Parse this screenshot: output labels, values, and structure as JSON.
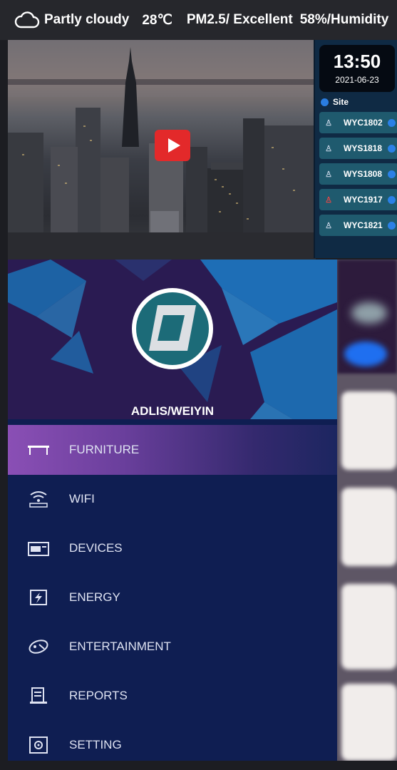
{
  "status_bar": {
    "weather_icon": "cloud-icon",
    "weather": "Partly cloudy",
    "temperature": "28℃",
    "air_quality": "PM2.5/ Excellent",
    "humidity": "58%/Humidity"
  },
  "video": {
    "play_icon": "play-icon"
  },
  "side_panel": {
    "time": "13:50",
    "date": "2021-06-23",
    "site_label": "Site",
    "devices": [
      {
        "name": "WYC1802",
        "status": "normal"
      },
      {
        "name": "WYS1818",
        "status": "normal"
      },
      {
        "name": "WYS1808",
        "status": "normal"
      },
      {
        "name": "WYC1917",
        "status": "alert"
      },
      {
        "name": "WYC1821",
        "status": "normal"
      }
    ]
  },
  "drawer": {
    "brand": "ADLIS/WEIYIN",
    "menu": [
      {
        "label": "FURNITURE",
        "icon": "table-icon",
        "active": true
      },
      {
        "label": "WIFI",
        "icon": "wifi-icon",
        "active": false
      },
      {
        "label": "DEVICES",
        "icon": "devices-icon",
        "active": false
      },
      {
        "label": "ENERGY",
        "icon": "energy-icon",
        "active": false
      },
      {
        "label": "ENTERTAINMENT",
        "icon": "entertainment-icon",
        "active": false
      },
      {
        "label": "REPORTS",
        "icon": "reports-icon",
        "active": false
      },
      {
        "label": "SETTING",
        "icon": "setting-icon",
        "active": false
      }
    ]
  },
  "colors": {
    "drawer_background": "#0f1e52",
    "active_item_gradient_start": "#8a4fb5",
    "header_background": "#2a1b52",
    "play_button": "#e3292a",
    "status_dot": "#2a80e6",
    "alert_icon": "#e04848"
  }
}
